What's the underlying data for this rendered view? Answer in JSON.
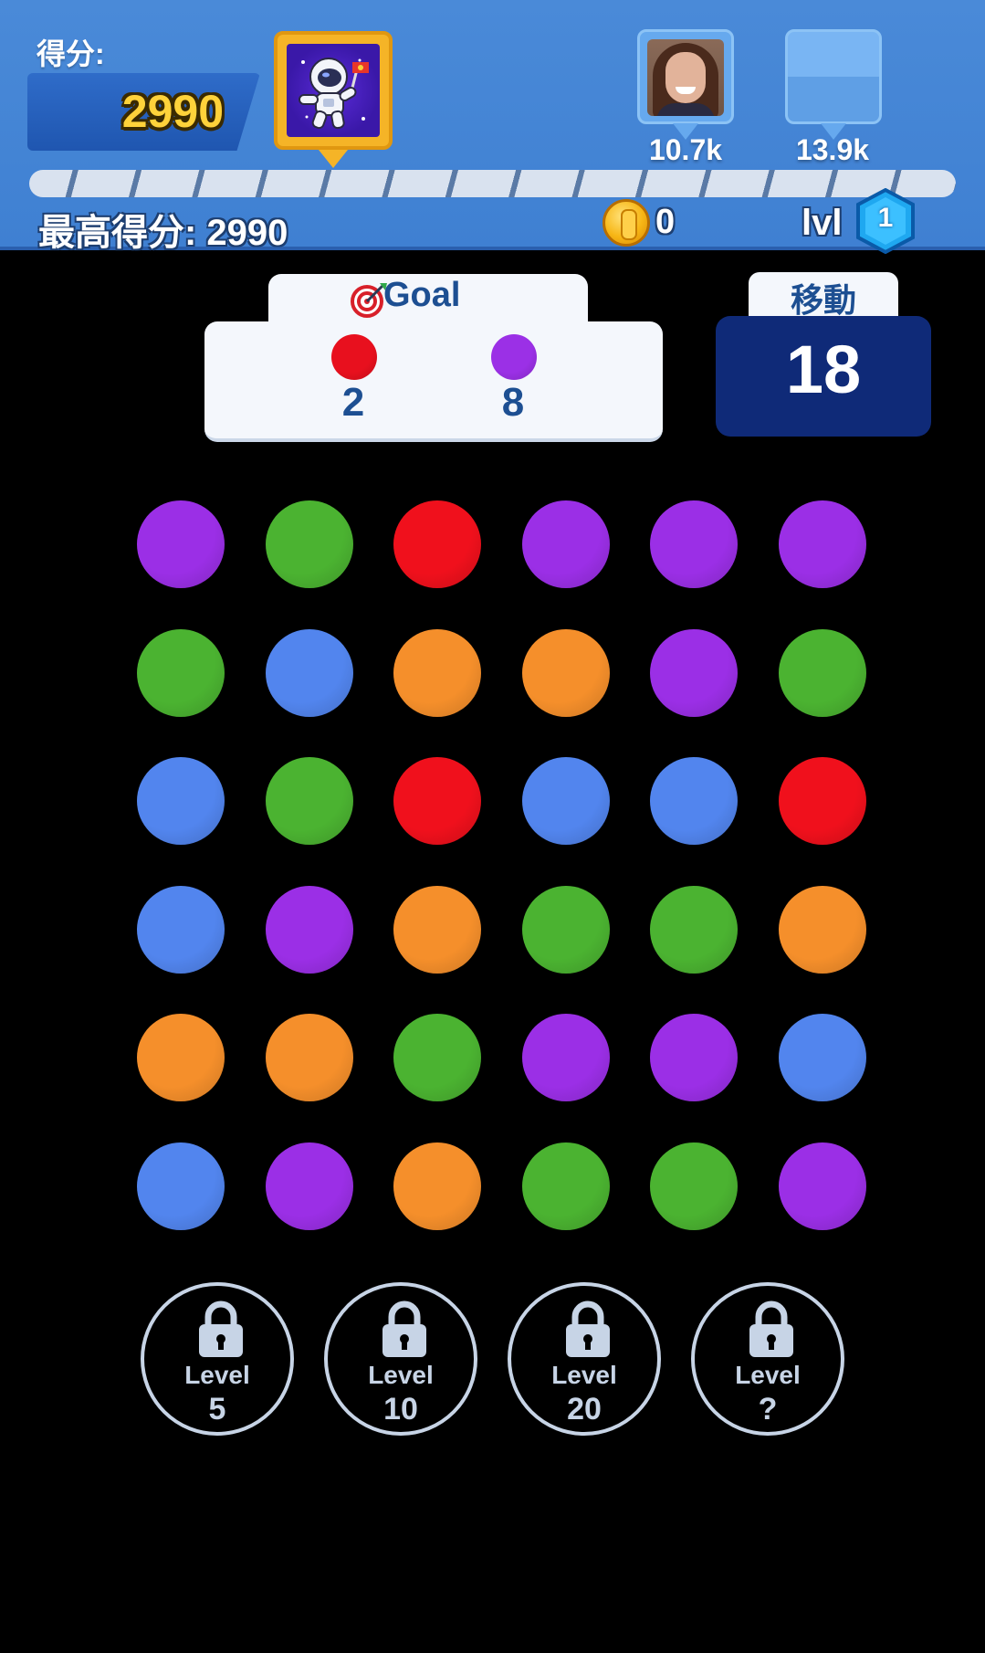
{
  "header": {
    "score_label": "得分:",
    "score_value": "2990",
    "player_avatar_icon": "astronaut-icon",
    "opponents": [
      {
        "score": "10.7k",
        "avatar": "person-photo"
      },
      {
        "score": "13.9k",
        "avatar": "blank-avatar"
      }
    ],
    "best_label": "最高得分: 2990",
    "coins": "0",
    "lvl_label": "lvl",
    "lvl_value": "1"
  },
  "goal": {
    "title": "Goal",
    "icon": "target-icon",
    "items": [
      {
        "color": "#e8101e",
        "count": "2"
      },
      {
        "color": "#9b30e6",
        "count": "8"
      }
    ]
  },
  "moves": {
    "label": "移動",
    "value": "18"
  },
  "colors": {
    "purple": "#9b2fe6",
    "green": "#4bb331",
    "red": "#f0101c",
    "orange": "#f58f2b",
    "blue": "#5285ee"
  },
  "board": [
    [
      "purple",
      "green",
      "red",
      "purple",
      "purple",
      "purple"
    ],
    [
      "green",
      "blue",
      "orange",
      "orange",
      "purple",
      "green"
    ],
    [
      "blue",
      "green",
      "red",
      "blue",
      "blue",
      "red"
    ],
    [
      "blue",
      "purple",
      "orange",
      "green",
      "green",
      "orange"
    ],
    [
      "orange",
      "orange",
      "green",
      "purple",
      "purple",
      "blue"
    ],
    [
      "blue",
      "purple",
      "orange",
      "green",
      "green",
      "purple"
    ]
  ],
  "locked_levels": [
    {
      "label": "Level",
      "value": "5"
    },
    {
      "label": "Level",
      "value": "10"
    },
    {
      "label": "Level",
      "value": "20"
    },
    {
      "label": "Level",
      "value": "?"
    }
  ]
}
